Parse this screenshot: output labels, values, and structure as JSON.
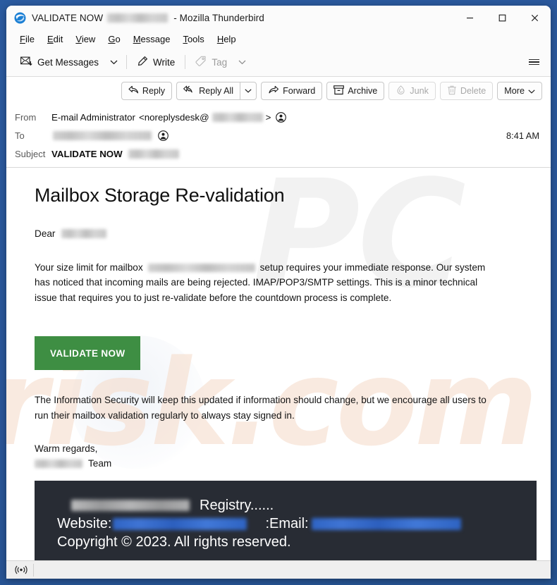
{
  "window": {
    "title_prefix": "VALIDATE NOW",
    "title_redacted": true,
    "title_suffix": "- Mozilla Thunderbird",
    "app_icon": "thunderbird-icon",
    "controls": {
      "minimize": "—",
      "maximize": "□",
      "close": "✕"
    }
  },
  "menubar": {
    "items": [
      {
        "accesskey": "F",
        "rest": "ile"
      },
      {
        "accesskey": "E",
        "rest": "dit"
      },
      {
        "accesskey": "V",
        "rest": "iew"
      },
      {
        "accesskey": "G",
        "rest": "o"
      },
      {
        "accesskey": "M",
        "rest": "essage"
      },
      {
        "accesskey": "T",
        "rest": "ools"
      },
      {
        "accesskey": "H",
        "rest": "elp"
      }
    ]
  },
  "toolbar": {
    "get_messages_label": "Get Messages",
    "write_label": "Write",
    "tag_label": "Tag",
    "app_menu": "hamburger-icon"
  },
  "message_actions": {
    "reply": "Reply",
    "reply_all": "Reply All",
    "forward": "Forward",
    "archive": "Archive",
    "junk": "Junk",
    "delete": "Delete",
    "more": "More"
  },
  "headers": {
    "from_label": "From",
    "from_display_name": "E-mail Administrator",
    "from_address_open": "<noreplysdesk@",
    "from_address_close": ">",
    "to_label": "To",
    "subject_label": "Subject",
    "subject_value": "VALIDATE NOW",
    "time": "8:41 AM"
  },
  "mail": {
    "heading": "Mailbox Storage Re-validation",
    "dear_label": "Dear",
    "para1_before": "Your size limit for mailbox",
    "para1_after": "setup requires your immediate response. Our system has noticed that incoming mails are being rejected. IMAP/POP3/SMTP settings. This is a minor technical issue that requires you to just re-validate before the countdown process is complete.",
    "cta_label": "VALIDATE NOW",
    "para2": "The Information Security will keep this updated if information should change, but we encourage all users to run their mailbox validation regularly to always stay signed in.",
    "signoff_line1": "Warm regards,",
    "signoff_team_suffix": "Team"
  },
  "mail_footer": {
    "registry_text": "Registry......",
    "website_label": "Website:",
    "email_label": ":Email:",
    "copyright": "Copyright © 2023. All rights reserved.",
    "background_color": "#282c34"
  },
  "statusbar": {
    "icon": "broadcast-icon",
    "icon_glyph": "((o))"
  },
  "watermark": {
    "top_text": "PC",
    "bottom_text": "risk.com"
  },
  "colors": {
    "cta_green": "#3e8e43",
    "footer_dark": "#282c34",
    "desktop_blue": "#2a5699",
    "link_blue": "#2f64c4"
  }
}
